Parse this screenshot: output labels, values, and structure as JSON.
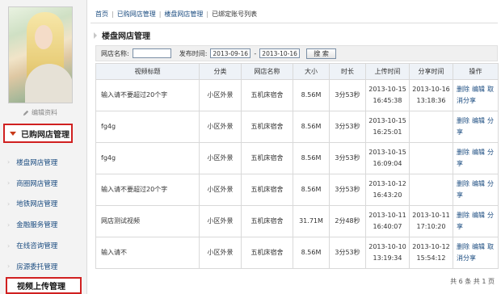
{
  "sidebar": {
    "edit_profile": "编辑资料",
    "purchased": "已购网店管理",
    "items": [
      {
        "label": "楼盘网店管理"
      },
      {
        "label": "商圈网店管理"
      },
      {
        "label": "地铁网店管理"
      },
      {
        "label": "金融服务管理"
      },
      {
        "label": "在线咨询管理"
      },
      {
        "label": "房源委托管理"
      }
    ],
    "active_item": "视频上传管理"
  },
  "breadcrumb": [
    "首页",
    "已购网店管理",
    "楼盘网店管理",
    "已绑定账号列表"
  ],
  "section_title": "楼盘网店管理",
  "filter": {
    "name_label": "网店名称:",
    "name_value": "",
    "time_label": "发布时间:",
    "date_from": "2013-09-16",
    "date_sep": "-",
    "date_to": "2013-10-16",
    "search_button": "搜 索"
  },
  "table": {
    "headers": [
      "视频标题",
      "分类",
      "网店名称",
      "大小",
      "时长",
      "上传时间",
      "分享时间",
      "操作"
    ],
    "rows": [
      {
        "title": "输入请不要超过20个字",
        "category": "小区外景",
        "shop": "五机床宿舍",
        "size": "8.56M",
        "duration": "3分53秒",
        "upload_date": "2013-10-15",
        "upload_time": "16:45:38",
        "share_date": "2013-10-16",
        "share_time": "13:18:36",
        "ops": [
          "删除",
          "编辑",
          "取消分享"
        ]
      },
      {
        "title": "fg4g",
        "category": "小区外景",
        "shop": "五机床宿舍",
        "size": "8.56M",
        "duration": "3分53秒",
        "upload_date": "2013-10-15",
        "upload_time": "16:25:01",
        "share_date": "",
        "share_time": "",
        "ops": [
          "删除",
          "编辑",
          "分享"
        ]
      },
      {
        "title": "fg4g",
        "category": "小区外景",
        "shop": "五机床宿舍",
        "size": "8.56M",
        "duration": "3分53秒",
        "upload_date": "2013-10-15",
        "upload_time": "16:09:04",
        "share_date": "",
        "share_time": "",
        "ops": [
          "删除",
          "编辑",
          "分享"
        ]
      },
      {
        "title": "输入请不要超过20个字",
        "category": "小区外景",
        "shop": "五机床宿舍",
        "size": "8.56M",
        "duration": "3分53秒",
        "upload_date": "2013-10-12",
        "upload_time": "16:43:20",
        "share_date": "",
        "share_time": "",
        "ops": [
          "删除",
          "编辑",
          "分享"
        ]
      },
      {
        "title": "网店测试视频",
        "category": "小区外景",
        "shop": "五机床宿舍",
        "size": "31.71M",
        "duration": "2分48秒",
        "upload_date": "2013-10-11",
        "upload_time": "16:40:07",
        "share_date": "2013-10-11",
        "share_time": "17:10:20",
        "ops": [
          "删除",
          "编辑",
          "分享"
        ]
      },
      {
        "title": "输入请不",
        "category": "小区外景",
        "shop": "五机床宿舍",
        "size": "8.56M",
        "duration": "3分53秒",
        "upload_date": "2013-10-10",
        "upload_time": "13:19:34",
        "share_date": "2013-10-12",
        "share_time": "15:54:12",
        "ops": [
          "删除",
          "编辑",
          "取消分享"
        ]
      }
    ]
  },
  "footer": "共 6 条 共 1 页"
}
